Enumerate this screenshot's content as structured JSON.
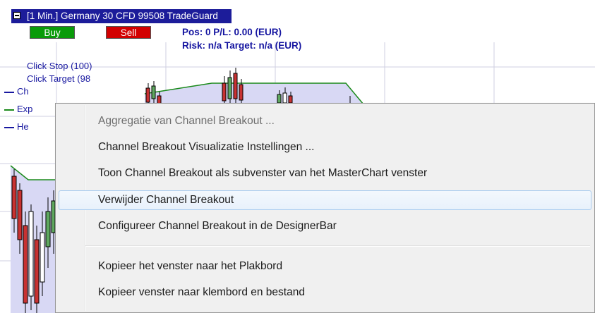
{
  "tradeguard": {
    "title": "[1 Min.] Germany 30 CFD  99508 TradeGuard",
    "buy_label": "Buy",
    "sell_label": "Sell",
    "position_line": "Pos: 0  P/L: 0.00  (EUR)",
    "risk_line": "Risk: n/a  Target: n/a (EUR)"
  },
  "legend": {
    "click_stop": "Click Stop  (100)",
    "click_target": "Click Target  (98",
    "line1": "Ch",
    "line2": "Exp",
    "line3": "He"
  },
  "context_menu": {
    "items": [
      {
        "label": "Aggregatie van Channel Breakout ...",
        "state": "disabled"
      },
      {
        "label": "Channel Breakout Visualizatie Instellingen ..."
      },
      {
        "label": "Toon Channel Breakout als subvenster van het MasterChart venster"
      },
      {
        "label": "Verwijder Channel Breakout",
        "state": "highlighted"
      },
      {
        "label": "Configureer Channel Breakout in de DesignerBar"
      },
      {
        "label": "Kopieer het venster naar het Plakbord"
      },
      {
        "label": "Kopieer venster naar klembord en bestand"
      }
    ]
  },
  "colors": {
    "title_bg": "#1c1c9a",
    "buy": "#0a9b0a",
    "sell": "#d20000",
    "status_text": "#1414a0",
    "menu_highlight_border": "#a8cbef"
  }
}
